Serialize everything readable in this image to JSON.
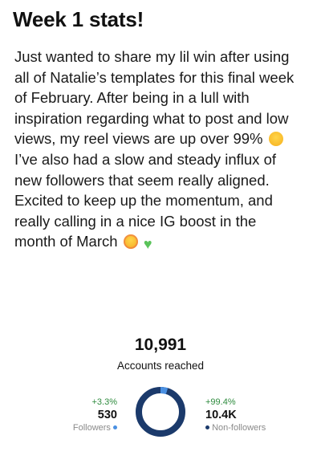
{
  "post": {
    "title": "Week 1 stats!",
    "body_line_1": "Just wanted to share my lil win after using",
    "body_line_2": "all of Natalie’s templates for this final week",
    "body_line_3": "of February. After being in a lull with",
    "body_line_4": "inspiration regarding what to post and low",
    "body_line_5": "views, my reel views are up over 99%",
    "body_line_6": "I’ve also had a slow and steady influx of",
    "body_line_7": "new followers that seem really aligned.",
    "body_line_8": "Excited to keep up the momentum, and",
    "body_line_9": "really calling in a nice IG boost in the",
    "body_line_10": "month of March",
    "emoji_after_line_5": "face-with-tears-of-joy-icon",
    "emoji_after_line_10": [
      "smiling-face-with-hearts-icon",
      "green-heart-icon"
    ]
  },
  "stats": {
    "accounts_reached": "10,991",
    "accounts_reached_label": "Accounts reached",
    "followers": {
      "change": "+3.3%",
      "value": "530",
      "label": "Followers",
      "color": "#4a90e2",
      "share": 0.048
    },
    "non_followers": {
      "change": "+99.4%",
      "value": "10.4K",
      "label": "Non-followers",
      "color": "#1b3a6b",
      "share": 0.952
    }
  },
  "colors": {
    "positive_change": "#2e8b3e",
    "label_gray": "#8a8a8a"
  }
}
